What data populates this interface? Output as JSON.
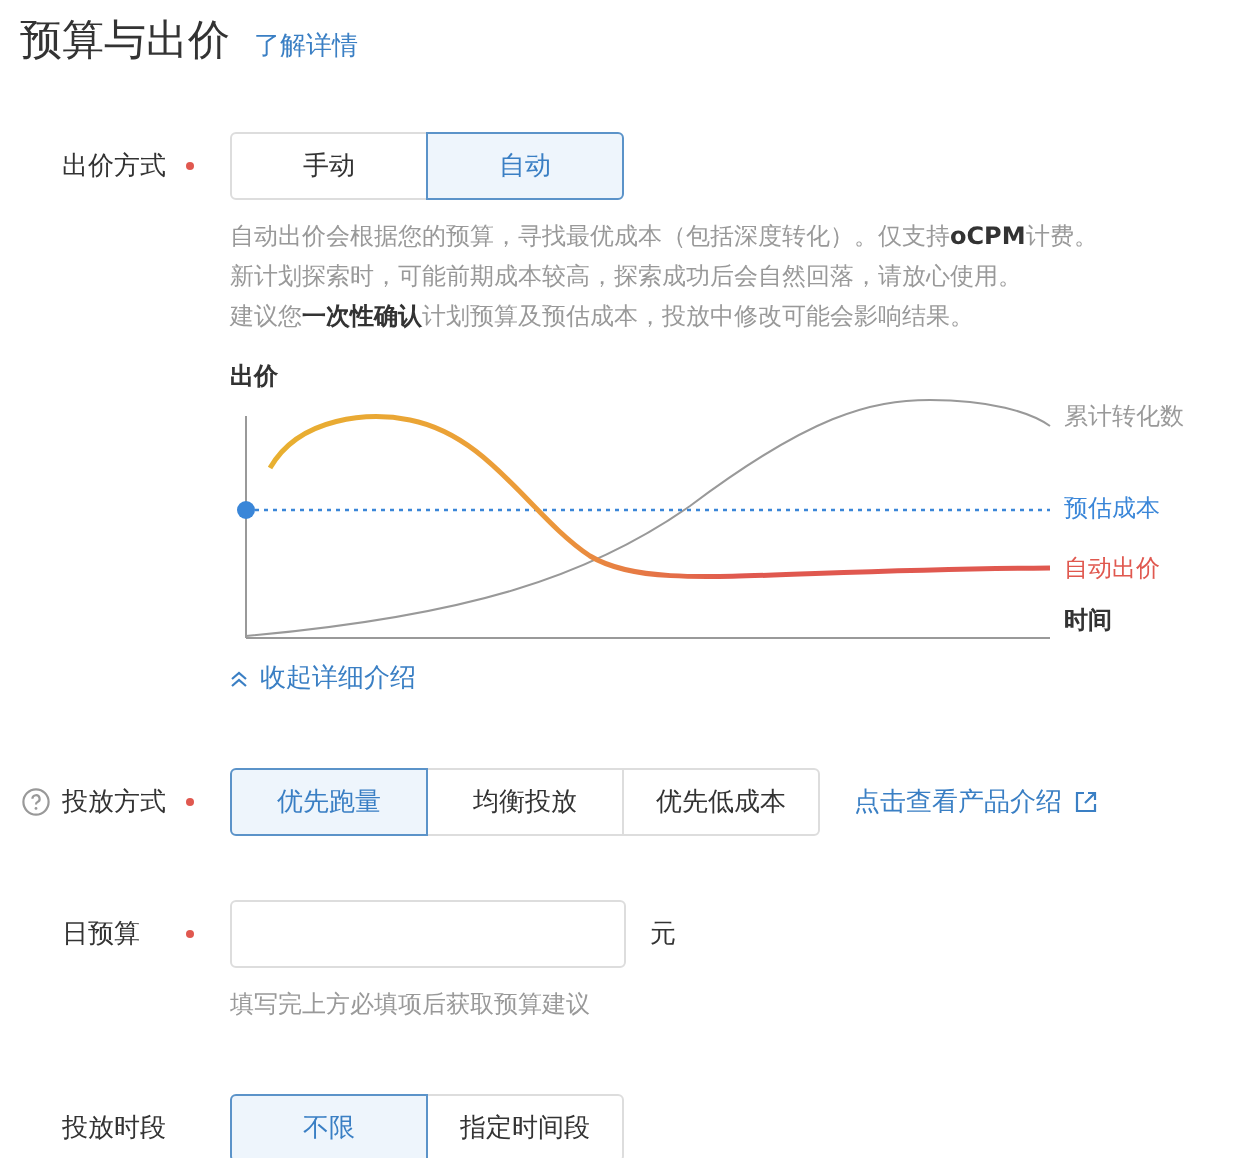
{
  "header": {
    "title": "预算与出价",
    "link": "了解详情"
  },
  "bid_mode": {
    "label": "出价方式",
    "required": true,
    "help": false,
    "options": [
      {
        "label": "手动",
        "selected": false
      },
      {
        "label": "自动",
        "selected": true
      }
    ],
    "description": [
      "自动出价会根据您的预算，寻找最优成本（包括深度转化）。仅支持**oCPM**计费。",
      "新计划探索时，可能前期成本较高，探索成功后会自然回落，请放心使用。",
      "建议您**一次性确认**计划预算及预估成本，投放中修改可能会影响结果。"
    ],
    "diagram": {
      "y_label": "出价",
      "x_label": "时间",
      "legend": [
        {
          "kind": "conversions",
          "label": "累计转化数",
          "color": "#999999"
        },
        {
          "kind": "estimate",
          "label": "预估成本",
          "color": "#3a86d8"
        },
        {
          "kind": "bid",
          "label": "自动出价",
          "color": "#e0584f"
        }
      ]
    },
    "collapse_link": "收起详细介绍"
  },
  "delivery_mode": {
    "label": "投放方式",
    "required": true,
    "help": true,
    "options": [
      {
        "label": "优先跑量",
        "selected": true
      },
      {
        "label": "均衡投放",
        "selected": false
      },
      {
        "label": "优先低成本",
        "selected": false
      }
    ],
    "link": "点击查看产品介绍"
  },
  "daily_budget": {
    "label": "日预算",
    "required": true,
    "help": false,
    "unit": "元",
    "hint": "填写完上方必填项后获取预算建议"
  },
  "schedule": {
    "label": "投放时段",
    "required": false,
    "help": false,
    "options": [
      {
        "label": "不限",
        "selected": true
      },
      {
        "label": "指定时间段",
        "selected": false
      }
    ]
  }
}
